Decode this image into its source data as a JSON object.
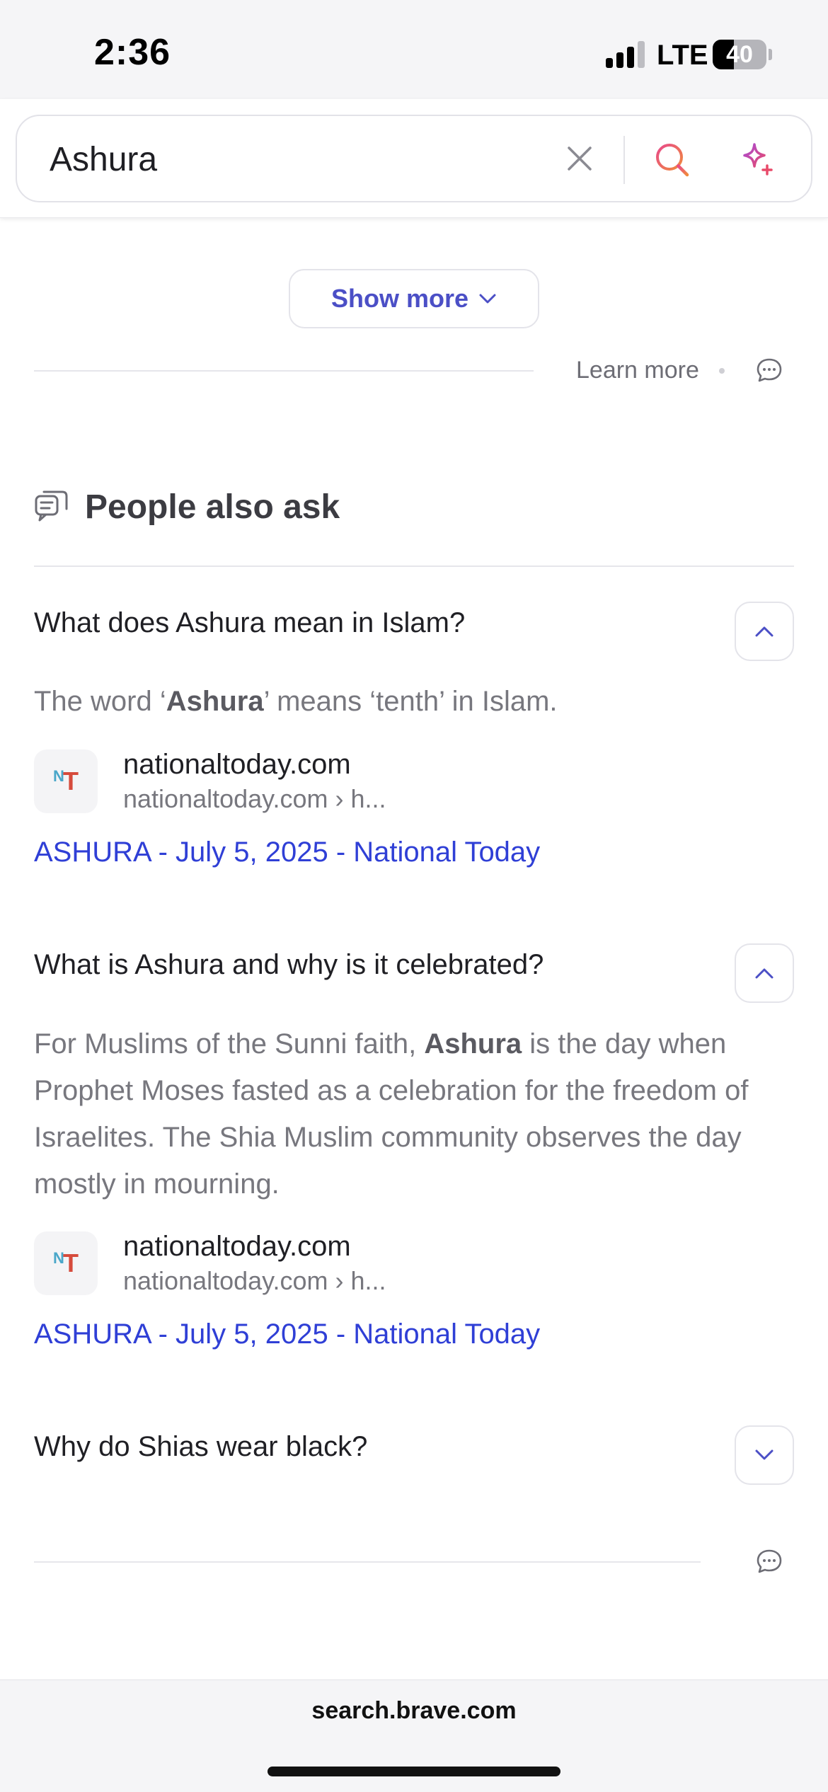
{
  "status_bar": {
    "time": "2:36",
    "network": "LTE",
    "battery": "40",
    "battery_level": 0.4
  },
  "search": {
    "query": "Ashura",
    "clear_icon": "close-icon",
    "search_icon": "search-icon",
    "ai_icon": "sparkle-icon"
  },
  "show_more": {
    "label": "Show more"
  },
  "footer_row": {
    "learn_more": "Learn more"
  },
  "people_also_ask": {
    "title": "People also ask",
    "items": [
      {
        "question": "What does Ashura mean in Islam?",
        "expanded": true,
        "answer_pre": "The word ‘",
        "answer_bold": "Ashura",
        "answer_post": "’ means ‘tenth’ in Islam.",
        "site_name": "nationaltoday.com",
        "site_url": "nationaltoday.com  › h...",
        "link": "ASHURA - July 5, 2025 - National Today"
      },
      {
        "question": "What is Ashura and why is it celebrated?",
        "expanded": true,
        "answer_pre": "For Muslims of the Sunni faith, ",
        "answer_bold": "Ashura",
        "answer_post": " is the day when Prophet Moses fasted as a celebration for the freedom of Israelites. The Shia Muslim community observes the day mostly in mourning.",
        "site_name": "nationaltoday.com",
        "site_url": "nationaltoday.com  › h...",
        "link": "ASHURA - July 5, 2025 - National Today"
      },
      {
        "question": "Why do Shias wear black?",
        "expanded": false
      }
    ]
  },
  "favicon": {
    "letter_small": "N",
    "letter_big": "T"
  },
  "bottom_bar": {
    "domain": "search.brave.com"
  },
  "colors": {
    "accent": "#4b4fc6",
    "link": "#2f3fd6",
    "brand_red": "#d64b3c",
    "brand_blue": "#4aa7c9"
  }
}
